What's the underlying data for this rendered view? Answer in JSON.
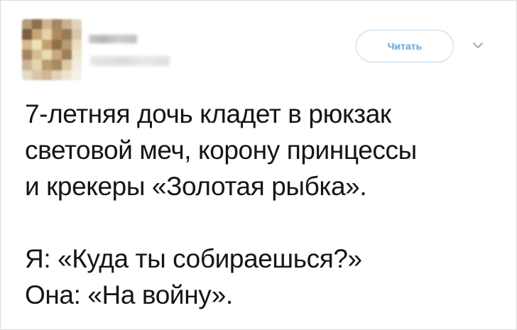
{
  "tweet": {
    "author": {
      "avatar_colors": [
        "#b49a76",
        "#8c6f4e",
        "#d1b48e",
        "#a58764",
        "#cbb18f",
        "#e2d3bf",
        "#7d5e3e",
        "#c7a57a",
        "#e6d2a8",
        "#b08a5c",
        "#9a7b57",
        "#d9c6a8",
        "#d4b88e",
        "#f0e1b8",
        "#c29e6b",
        "#8f6f48",
        "#b79b72",
        "#e8dcc4",
        "#a6855d",
        "#d6bd93",
        "#eadbb4",
        "#c8a97b",
        "#9c7f5a",
        "#efe6d3",
        "#c9b697",
        "#e4d4b0",
        "#b99c70",
        "#a78a63",
        "#dcc9a6",
        "#f3ece0",
        "#e5dac7",
        "#d8c7a8",
        "#cdb999",
        "#e0d2b9",
        "#ece3d3",
        "#f5f0e8"
      ]
    },
    "follow_button": {
      "label": "Читать"
    },
    "menu": {
      "icon": "chevron-down-icon"
    },
    "text_lines_1": [
      "7-летняя дочь кладет в рюкзак",
      "световой меч, корону принцессы",
      "и крекеры «Золотая рыбка»."
    ],
    "text_lines_2": [
      "Я: «Куда ты собираешься?»",
      "Она: «На войну»."
    ]
  },
  "colors": {
    "accent": "#5aa2d6",
    "text": "#151515",
    "border": "#dcdcdc"
  }
}
